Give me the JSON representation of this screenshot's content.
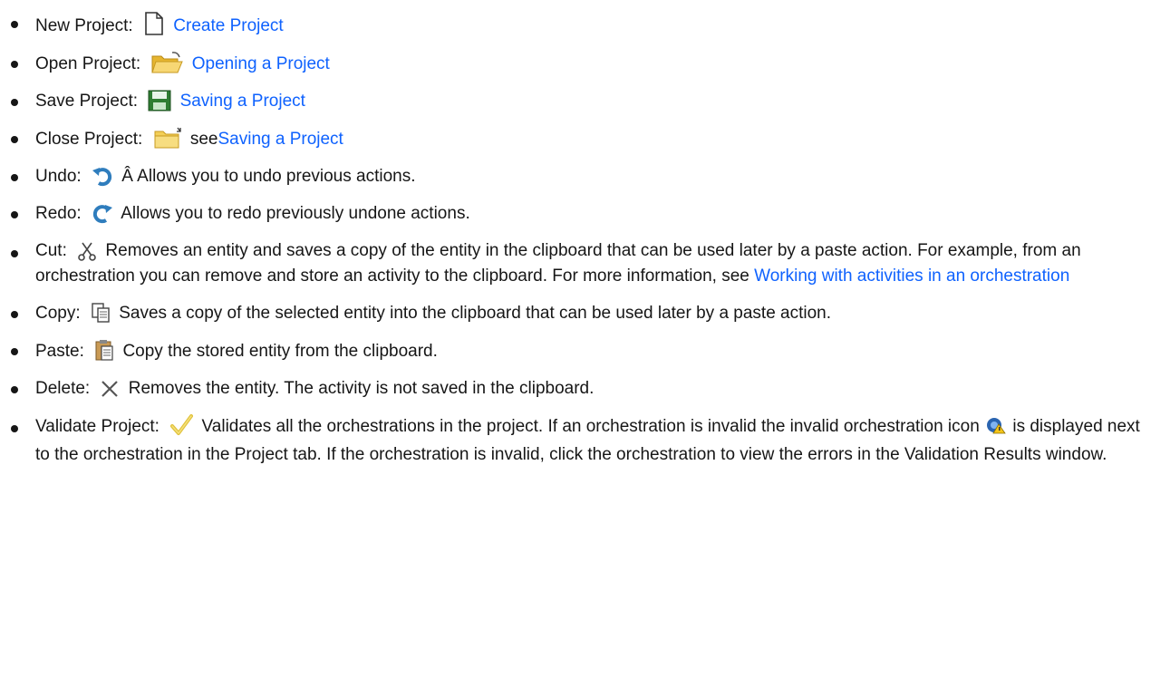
{
  "items": [
    {
      "label": "New Project:",
      "icon": "new-document-icon",
      "link": "Create Project"
    },
    {
      "label": "Open Project:",
      "icon": "open-folder-icon",
      "link": "Opening a Project"
    },
    {
      "label": "Save Project:",
      "icon": "floppy-disk-icon",
      "link": "Saving a Project"
    },
    {
      "label": "Close Project:",
      "icon": "close-folder-icon",
      "prefix": "see",
      "link": "Saving a Project"
    },
    {
      "label": "Undo:",
      "icon": "undo-icon",
      "text": "Â Allows you to undo previous actions."
    },
    {
      "label": "Redo:",
      "icon": "redo-icon",
      "text": "Allows you to redo previously undone actions."
    },
    {
      "label": "Cut:",
      "icon": "scissors-icon",
      "text": "Removes an entity and saves a copy of the entity in the clipboard that can be used later by a paste action. For example, from an orchestration you can remove and store an activity to the clipboard. For more information, see",
      "link": "Working with activities in an orchestration"
    },
    {
      "label": "Copy:",
      "icon": "copy-icon",
      "text": "Saves a copy of the selected entity into the clipboard that can be used later by a paste action."
    },
    {
      "label": "Paste:",
      "icon": "paste-icon",
      "text": "Copy the stored entity from the clipboard."
    },
    {
      "label": "Delete:",
      "icon": "delete-x-icon",
      "text": "Removes the entity. The activity is not saved in the clipboard."
    },
    {
      "label": "Validate Project:",
      "icon": "checkmark-icon",
      "text": "Validates all the orchestrations in the project. If an orchestration is invalid the invalid orchestration icon",
      "inline_icon": "invalid-orchestration-icon",
      "text2": "is displayed next to the orchestration in the Project tab. If the orchestration is invalid, click the orchestration to view the errors in the Validation Results window."
    }
  ],
  "colors": {
    "link": "#0f62fe",
    "text": "#161616"
  }
}
